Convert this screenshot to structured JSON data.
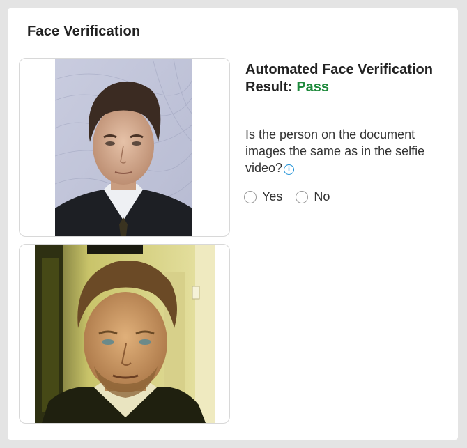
{
  "card": {
    "title": "Face Verification"
  },
  "images": {
    "document_photo": "document-portrait",
    "selfie_photo": "selfie-video-frame"
  },
  "result": {
    "label": "Automated Face Verification Result: ",
    "status": "Pass",
    "status_color": "#1e8a3c"
  },
  "question": {
    "text": "Is the person on the document images the same as in the selfie video?",
    "info_icon": "info-icon"
  },
  "options": [
    {
      "label": "Yes",
      "selected": false
    },
    {
      "label": "No",
      "selected": false
    }
  ]
}
